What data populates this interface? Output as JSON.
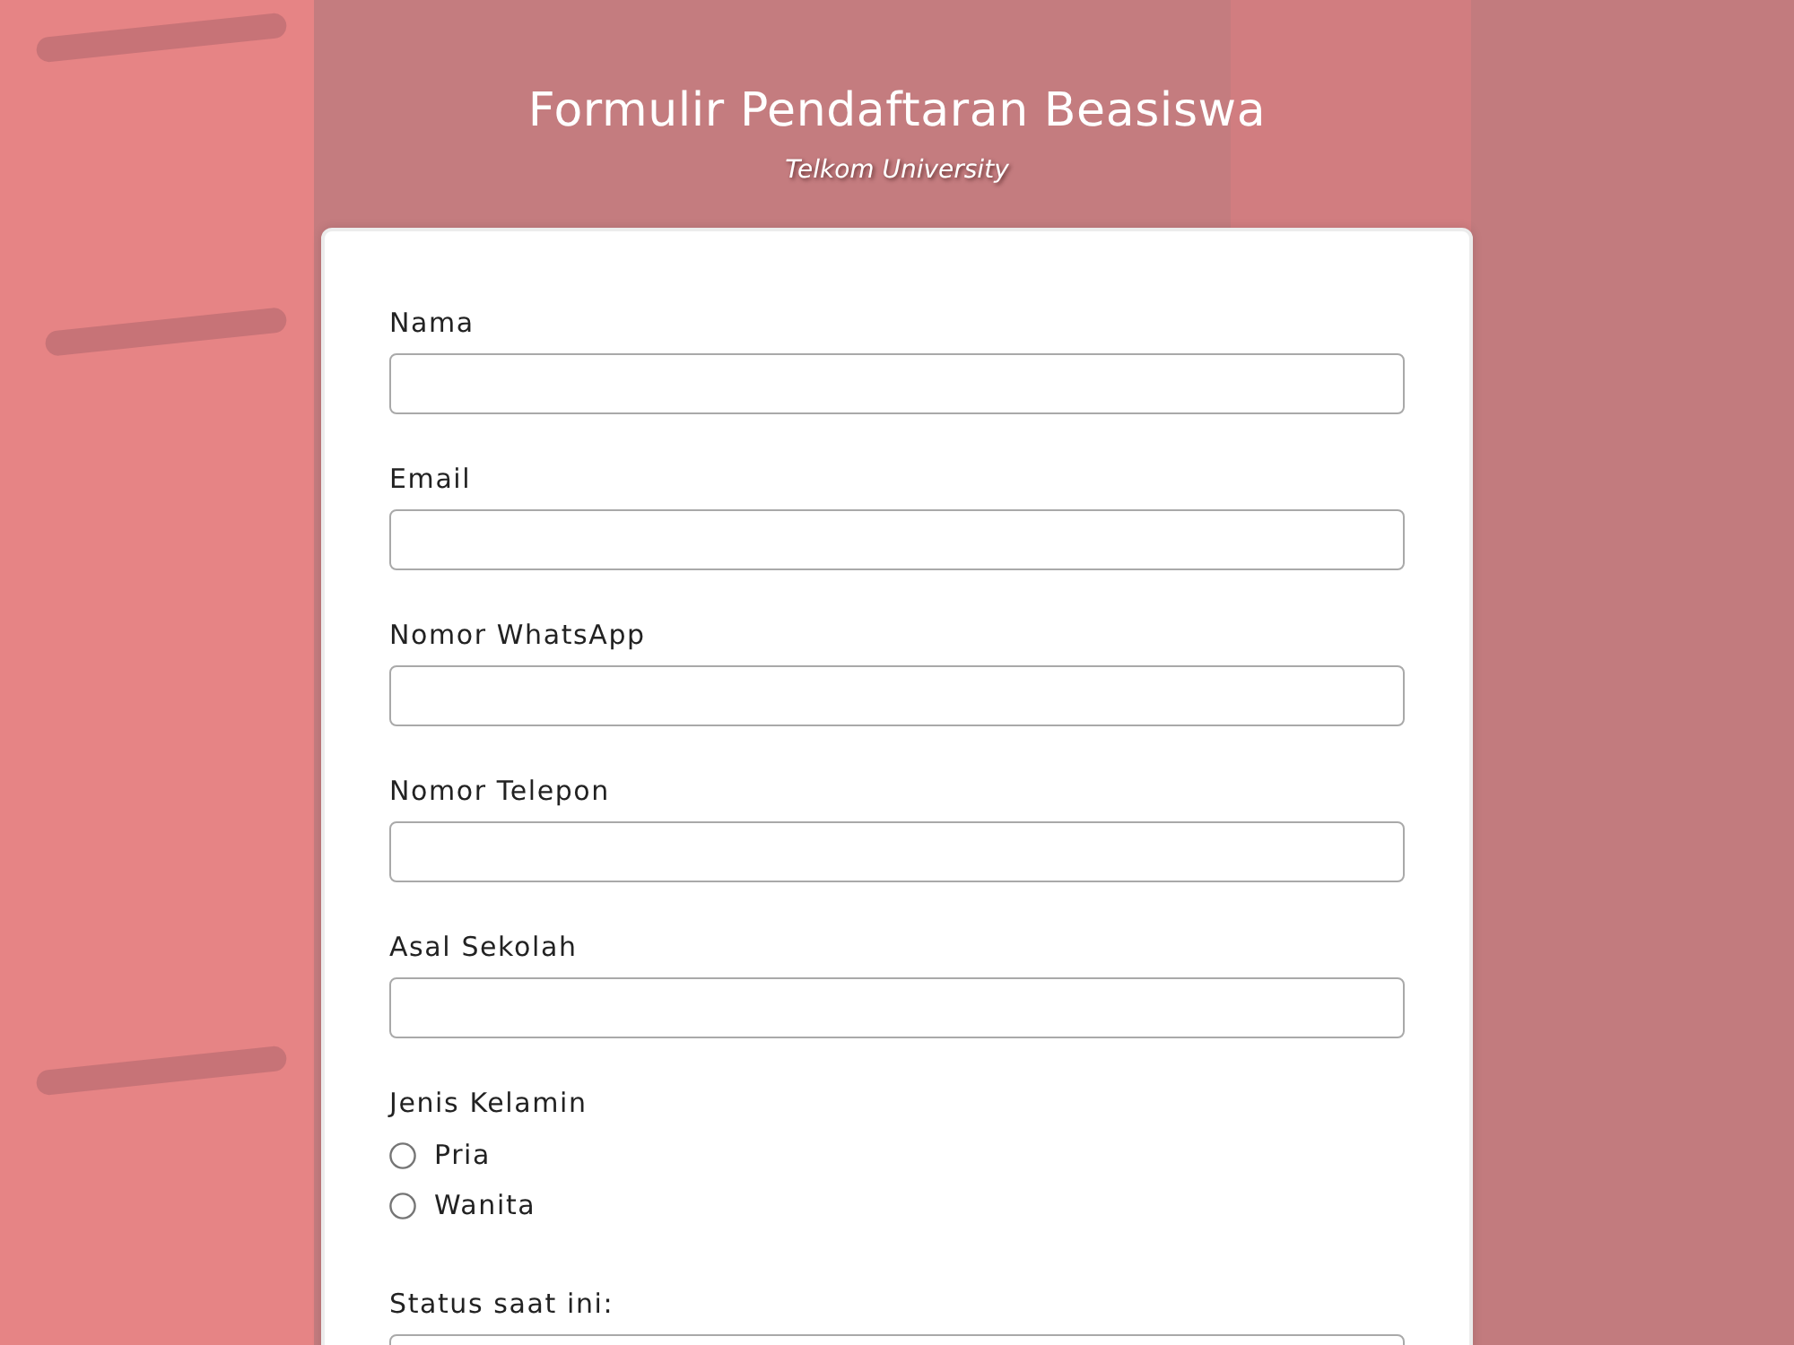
{
  "header": {
    "title": "Formulir Pendaftaran Beasiswa",
    "subtitle": "Telkom University"
  },
  "form": {
    "fields": [
      {
        "kind": "text",
        "label": "Nama"
      },
      {
        "kind": "text",
        "label": "Email"
      },
      {
        "kind": "text",
        "label": "Nomor WhatsApp"
      },
      {
        "kind": "text",
        "label": "Nomor Telepon"
      },
      {
        "kind": "text",
        "label": "Asal Sekolah"
      },
      {
        "kind": "radio",
        "label": "Jenis Kelamin",
        "options": [
          {
            "label": "Pria",
            "selected": false
          },
          {
            "label": "Wanita",
            "selected": false
          }
        ]
      },
      {
        "kind": "text",
        "label": "Status saat ini:"
      }
    ]
  }
}
